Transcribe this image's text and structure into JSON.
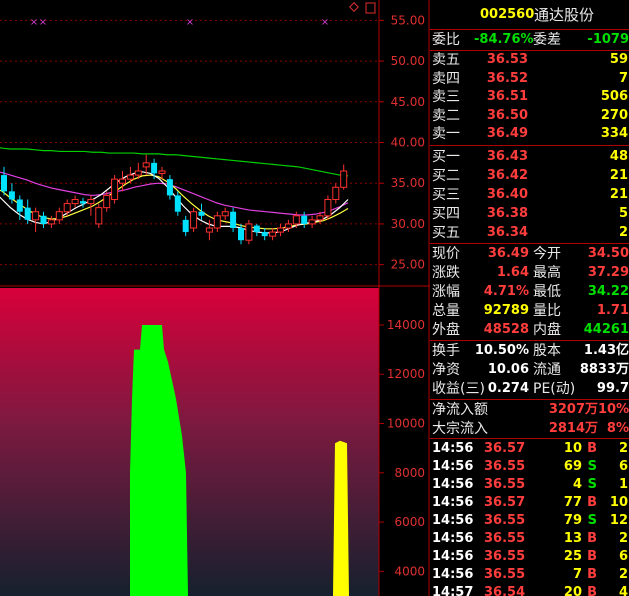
{
  "header": {
    "code": "002560",
    "name": "通达股份",
    "icons": [
      "diamond-icon",
      "square-icon"
    ]
  },
  "kline": {
    "y_ticks": [
      "55.00",
      "50.00",
      "45.00",
      "40.00",
      "35.00",
      "30.00",
      "25.00"
    ],
    "markers": [
      "×",
      "×",
      "×",
      "×"
    ]
  },
  "chip": {
    "y_ticks": [
      "14000",
      "12000",
      "10000",
      "8000",
      "6000",
      "4000"
    ]
  },
  "chart_data": [
    {
      "type": "candlestick",
      "y_range": [
        22.5,
        57.5
      ],
      "y_ticks": [
        55,
        50,
        45,
        40,
        35,
        30,
        25
      ],
      "candles": [
        {
          "o": 36,
          "h": 37,
          "l": 33.5,
          "c": 34
        },
        {
          "o": 34,
          "h": 35,
          "l": 32.5,
          "c": 33
        },
        {
          "o": 33,
          "h": 33.5,
          "l": 30.5,
          "c": 31.5
        },
        {
          "o": 32,
          "h": 33,
          "l": 30,
          "c": 30.5
        },
        {
          "o": 30.5,
          "h": 32,
          "l": 29,
          "c": 31.5
        },
        {
          "o": 31,
          "h": 31.5,
          "l": 29.5,
          "c": 30
        },
        {
          "o": 30,
          "h": 31,
          "l": 29.5,
          "c": 30.5
        },
        {
          "o": 30.5,
          "h": 32,
          "l": 30,
          "c": 31.5
        },
        {
          "o": 31.5,
          "h": 33,
          "l": 31,
          "c": 32.5
        },
        {
          "o": 32.5,
          "h": 33.5,
          "l": 32,
          "c": 33
        },
        {
          "o": 32.8,
          "h": 33.2,
          "l": 32,
          "c": 32.5
        },
        {
          "o": 32.5,
          "h": 33.5,
          "l": 31,
          "c": 33
        },
        {
          "o": 30,
          "h": 32.5,
          "l": 29.5,
          "c": 32
        },
        {
          "o": 32,
          "h": 34,
          "l": 31.5,
          "c": 33.5
        },
        {
          "o": 33,
          "h": 36,
          "l": 32.5,
          "c": 35.5
        },
        {
          "o": 35,
          "h": 36.5,
          "l": 34,
          "c": 35.5
        },
        {
          "o": 35.5,
          "h": 37,
          "l": 35,
          "c": 36
        },
        {
          "o": 36,
          "h": 37.5,
          "l": 35.5,
          "c": 36.5
        },
        {
          "o": 37,
          "h": 38.5,
          "l": 36,
          "c": 37.5
        },
        {
          "o": 37.5,
          "h": 38,
          "l": 35.5,
          "c": 36.2
        },
        {
          "o": 36.2,
          "h": 37,
          "l": 35.5,
          "c": 36.5
        },
        {
          "o": 35.5,
          "h": 36,
          "l": 33,
          "c": 33.5
        },
        {
          "o": 33.5,
          "h": 34,
          "l": 31,
          "c": 31.5
        },
        {
          "o": 30.5,
          "h": 31,
          "l": 28.5,
          "c": 29
        },
        {
          "o": 29.5,
          "h": 32,
          "l": 29,
          "c": 31.5
        },
        {
          "o": 31.5,
          "h": 32.5,
          "l": 30.5,
          "c": 31
        },
        {
          "o": 29,
          "h": 30.5,
          "l": 28,
          "c": 29.5
        },
        {
          "o": 29.5,
          "h": 31.5,
          "l": 29,
          "c": 31
        },
        {
          "o": 31,
          "h": 32,
          "l": 30.5,
          "c": 31.5
        },
        {
          "o": 31.5,
          "h": 32,
          "l": 29,
          "c": 29.5
        },
        {
          "o": 29.5,
          "h": 30,
          "l": 27.5,
          "c": 28
        },
        {
          "o": 28,
          "h": 30.5,
          "l": 27.5,
          "c": 30
        },
        {
          "o": 29.8,
          "h": 30,
          "l": 28.5,
          "c": 29
        },
        {
          "o": 29,
          "h": 29.5,
          "l": 28,
          "c": 28.5
        },
        {
          "o": 28.5,
          "h": 29.5,
          "l": 28,
          "c": 29
        },
        {
          "o": 29,
          "h": 30,
          "l": 28.5,
          "c": 29.5
        },
        {
          "o": 29.5,
          "h": 30.5,
          "l": 29,
          "c": 30
        },
        {
          "o": 30,
          "h": 31.5,
          "l": 29.5,
          "c": 31
        },
        {
          "o": 31,
          "h": 31.5,
          "l": 29.5,
          "c": 30
        },
        {
          "o": 30,
          "h": 31,
          "l": 29.5,
          "c": 30.5
        },
        {
          "o": 30.5,
          "h": 31.5,
          "l": 30,
          "c": 31
        },
        {
          "o": 31,
          "h": 33.5,
          "l": 30.5,
          "c": 33
        },
        {
          "o": 33,
          "h": 35,
          "l": 32.5,
          "c": 34.5
        },
        {
          "o": 34.5,
          "h": 37.3,
          "l": 34.2,
          "c": 36.5
        }
      ],
      "ma_lines": [
        {
          "color": "#00d000",
          "values": [
            39.5,
            39.3,
            39.2,
            39.2,
            39.2,
            39.1,
            39.0,
            39.0,
            38.9,
            38.9,
            38.9,
            38.9,
            38.8,
            38.8,
            38.7,
            38.7,
            38.7,
            38.7,
            38.6,
            38.6,
            38.6,
            38.5,
            38.5,
            38.4,
            38.3,
            38.2,
            38.1,
            38.0,
            37.9,
            37.8,
            37.7,
            37.6,
            37.5,
            37.4,
            37.3,
            37.2,
            37.1,
            37.0,
            36.8,
            36.6,
            36.4,
            36.2,
            36.0,
            35.9
          ]
        },
        {
          "color": "#e040e0",
          "values": [
            36.5,
            36.3,
            36.0,
            35.7,
            35.4,
            35.0,
            34.7,
            34.4,
            34.2,
            34.0,
            33.8,
            33.6,
            33.5,
            33.6,
            33.8,
            34.0,
            34.2,
            34.5,
            34.7,
            34.9,
            35.0,
            34.9,
            34.6,
            34.2,
            33.8,
            33.4,
            33.0,
            32.6,
            32.3,
            32.1,
            31.9,
            31.7,
            31.6,
            31.5,
            31.4,
            31.3,
            31.2,
            31.1,
            31.1,
            31.2,
            31.4,
            31.7,
            32.1,
            32.6
          ]
        },
        {
          "color": "#ffff40",
          "values": [
            34.5,
            34.0,
            33.2,
            32.5,
            31.8,
            31.2,
            30.8,
            30.6,
            30.7,
            31.0,
            31.4,
            31.8,
            32.2,
            32.8,
            33.5,
            34.2,
            34.9,
            35.5,
            35.9,
            36.0,
            35.8,
            35.2,
            34.4,
            33.4,
            32.5,
            31.7,
            31.0,
            30.5,
            30.3,
            30.1,
            29.8,
            29.6,
            29.5,
            29.4,
            29.4,
            29.5,
            29.7,
            29.9,
            30.0,
            30.2,
            30.4,
            30.8,
            31.3,
            31.9
          ]
        },
        {
          "color": "#ffffff",
          "values": [
            34.0,
            33.0,
            32.0,
            31.2,
            30.6,
            30.2,
            30.0,
            30.3,
            30.8,
            31.4,
            32.0,
            32.5,
            33.0,
            33.6,
            34.4,
            35.2,
            35.8,
            36.2,
            36.4,
            36.2,
            35.6,
            34.6,
            33.4,
            32.2,
            31.2,
            30.5,
            30.0,
            29.7,
            29.7,
            29.7,
            29.5,
            29.2,
            29.0,
            28.9,
            28.9,
            29.1,
            29.5,
            29.9,
            30.1,
            30.3,
            30.6,
            31.2,
            32.0,
            33.0
          ]
        }
      ]
    },
    {
      "type": "area",
      "y_range": [
        3000,
        15500
      ],
      "y_ticks": [
        14000,
        12000,
        10000,
        8000,
        6000,
        4000
      ],
      "series": [
        {
          "color": "#00ff00",
          "points": [
            [
              130,
              3000
            ],
            [
              130,
              8000
            ],
            [
              132,
              11000
            ],
            [
              134,
              13000
            ],
            [
              140,
              13000
            ],
            [
              142,
              14000
            ],
            [
              162,
              14000
            ],
            [
              164,
              13000
            ],
            [
              168,
              12500
            ],
            [
              176,
              11000
            ],
            [
              182,
              9500
            ],
            [
              186,
              8000
            ],
            [
              188,
              3000
            ]
          ]
        },
        {
          "color": "#ffff00",
          "points": [
            [
              333,
              3000
            ],
            [
              335,
              9200
            ],
            [
              340,
              9300
            ],
            [
              347,
              9200
            ],
            [
              349,
              3000
            ]
          ]
        }
      ]
    }
  ],
  "orderbook": {
    "webi_label": "委比",
    "webi_value": "-84.76%",
    "weicha_label": "委差",
    "weicha_value": "-1079",
    "asks": [
      {
        "label": "卖五",
        "price": "36.53",
        "vol": "59"
      },
      {
        "label": "卖四",
        "price": "36.52",
        "vol": "7"
      },
      {
        "label": "卖三",
        "price": "36.51",
        "vol": "506"
      },
      {
        "label": "卖二",
        "price": "36.50",
        "vol": "270"
      },
      {
        "label": "卖一",
        "price": "36.49",
        "vol": "334"
      }
    ],
    "bids": [
      {
        "label": "买一",
        "price": "36.43",
        "vol": "48"
      },
      {
        "label": "买二",
        "price": "36.42",
        "vol": "21"
      },
      {
        "label": "买三",
        "price": "36.40",
        "vol": "21"
      },
      {
        "label": "买四",
        "price": "36.38",
        "vol": "5"
      },
      {
        "label": "买五",
        "price": "36.34",
        "vol": "2"
      }
    ]
  },
  "stats": [
    {
      "l1": "现价",
      "v1": "36.49",
      "c1": "red",
      "l2": "今开",
      "v2": "34.50",
      "c2": "red"
    },
    {
      "l1": "涨跌",
      "v1": "1.64",
      "c1": "red",
      "l2": "最高",
      "v2": "37.29",
      "c2": "red"
    },
    {
      "l1": "涨幅",
      "v1": "4.71%",
      "c1": "red",
      "l2": "最低",
      "v2": "34.22",
      "c2": "green"
    },
    {
      "l1": "总量",
      "v1": "92789",
      "c1": "yel",
      "l2": "量比",
      "v2": "1.71",
      "c2": "red"
    },
    {
      "l1": "外盘",
      "v1": "48528",
      "c1": "red",
      "l2": "内盘",
      "v2": "44261",
      "c2": "green"
    }
  ],
  "stats2": [
    {
      "l1": "换手",
      "v1": "10.50%",
      "l2": "股本",
      "v2": "1.43亿"
    },
    {
      "l1": "净资",
      "v1": "10.06",
      "l2": "流通",
      "v2": "8833万"
    },
    {
      "l1": "收益(三)",
      "v1": "0.274",
      "l2": "PE(动)",
      "v2": "99.7"
    }
  ],
  "flow": [
    {
      "label": "净流入额",
      "value": "3207万",
      "pct": "10%"
    },
    {
      "label": "大宗流入",
      "value": "2814万",
      "pct": "8%"
    }
  ],
  "trades": [
    {
      "time": "14:56",
      "price": "36.57",
      "vol": "10",
      "side": "B",
      "n": "2",
      "c": "red"
    },
    {
      "time": "14:56",
      "price": "36.55",
      "vol": "69",
      "side": "S",
      "n": "6",
      "c": "green"
    },
    {
      "time": "14:56",
      "price": "36.55",
      "vol": "4",
      "side": "S",
      "n": "1",
      "c": "green"
    },
    {
      "time": "14:56",
      "price": "36.57",
      "vol": "77",
      "side": "B",
      "n": "10",
      "c": "red"
    },
    {
      "time": "14:56",
      "price": "36.55",
      "vol": "79",
      "side": "S",
      "n": "12",
      "c": "green"
    },
    {
      "time": "14:56",
      "price": "36.55",
      "vol": "13",
      "side": "B",
      "n": "2",
      "c": "red"
    },
    {
      "time": "14:56",
      "price": "36.55",
      "vol": "25",
      "side": "B",
      "n": "6",
      "c": "red"
    },
    {
      "time": "14:56",
      "price": "36.55",
      "vol": "7",
      "side": "B",
      "n": "2",
      "c": "red"
    },
    {
      "time": "14:57",
      "price": "36.54",
      "vol": "20",
      "side": "B",
      "n": "4",
      "c": "red"
    }
  ]
}
